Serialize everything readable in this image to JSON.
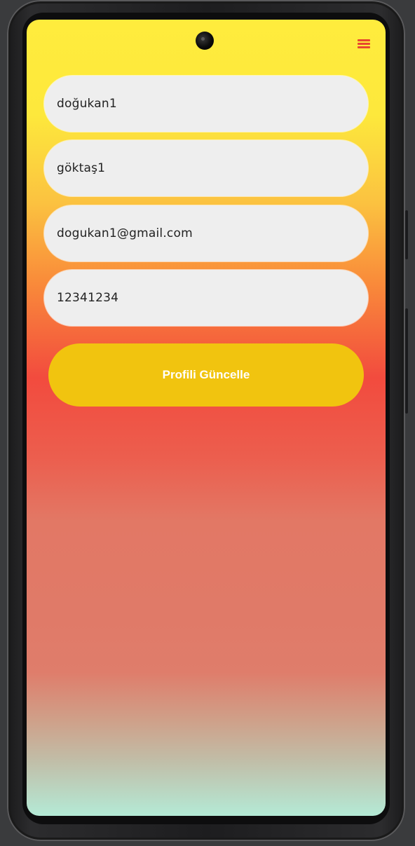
{
  "form": {
    "first_name": "doğukan1",
    "last_name": "göktaş1",
    "email": "dogukan1@gmail.com",
    "password": "12341234"
  },
  "update_button": {
    "label": "Profili Güncelle",
    "color": "#f1c40f"
  },
  "menu": {
    "icon": "hamburger-menu-icon",
    "color": "#e8482f"
  },
  "theme": {
    "gradient_top": "#ffec3d",
    "gradient_mid": "#f24b3e",
    "gradient_bottom": "#b4ead6",
    "field_background": "#eeeeee"
  }
}
